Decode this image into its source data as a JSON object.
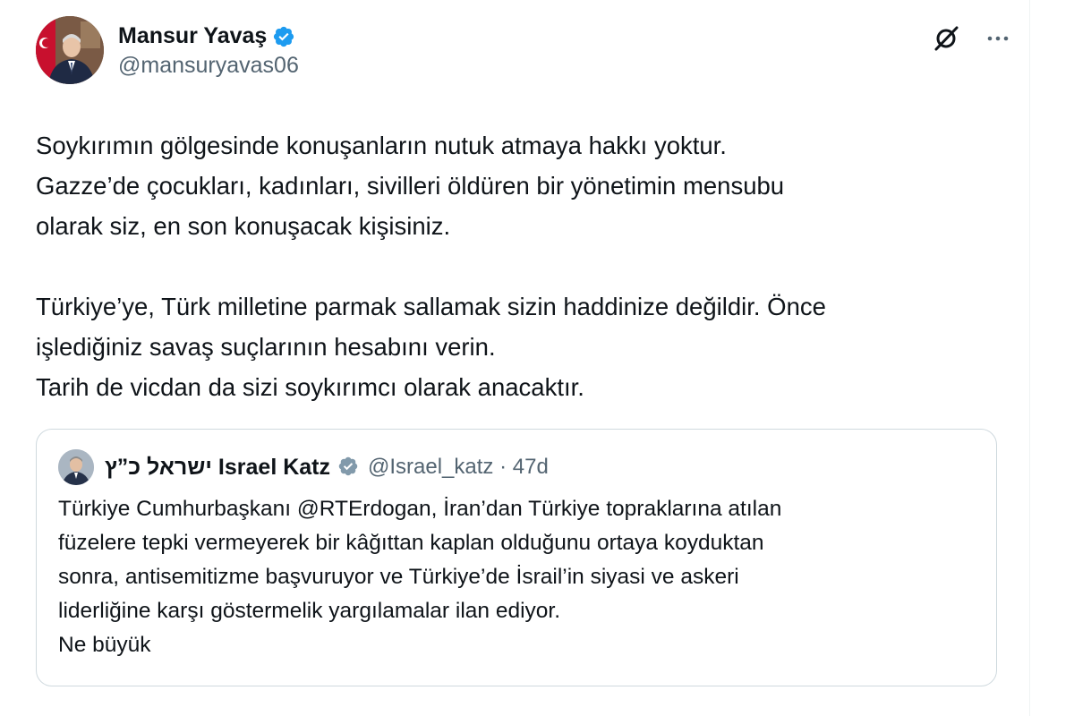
{
  "author": {
    "display_name": "Mansur Yavaş",
    "handle": "@mansuryavas06"
  },
  "icons": {
    "verified": "verified-badge-icon",
    "grok": "grok-icon",
    "more": "more-options-icon"
  },
  "colors": {
    "verified": "#1d9bf0",
    "text": "#0f1419",
    "muted": "#536471",
    "border": "#cfd9de"
  },
  "tweet": {
    "text": "Soykırımın gölgesinde konuşanların nutuk atmaya hakkı yoktur.\nGazze’de çocukları, kadınları, sivilleri öldüren bir yönetimin mensubu\nolarak siz, en son konuşacak kişisiniz.\n\nTürkiye’ye, Türk milletine parmak sallamak sizin haddinize değildir. Önce\nişlediğiniz savaş suçlarının hesabını verin.\nTarih de vicdan da sizi soykırımcı olarak anacaktır."
  },
  "quote": {
    "display_name": "ישראל כ”ץ Israel Katz",
    "handle_time": "@Israel_katz · 47d",
    "text": "Türkiye Cumhurbaşkanı @RTErdogan, İran’dan Türkiye topraklarına atılan\nfüzelere tepki vermeyerek bir kâğıttan kaplan olduğunu ortaya koyduktan\nsonra, antisemitizme başvuruyor ve Türkiye’de İsrail’in siyasi ve askeri\nliderliğine karşı göstermelik yargılamalar ilan ediyor.\nNe büyük"
  }
}
